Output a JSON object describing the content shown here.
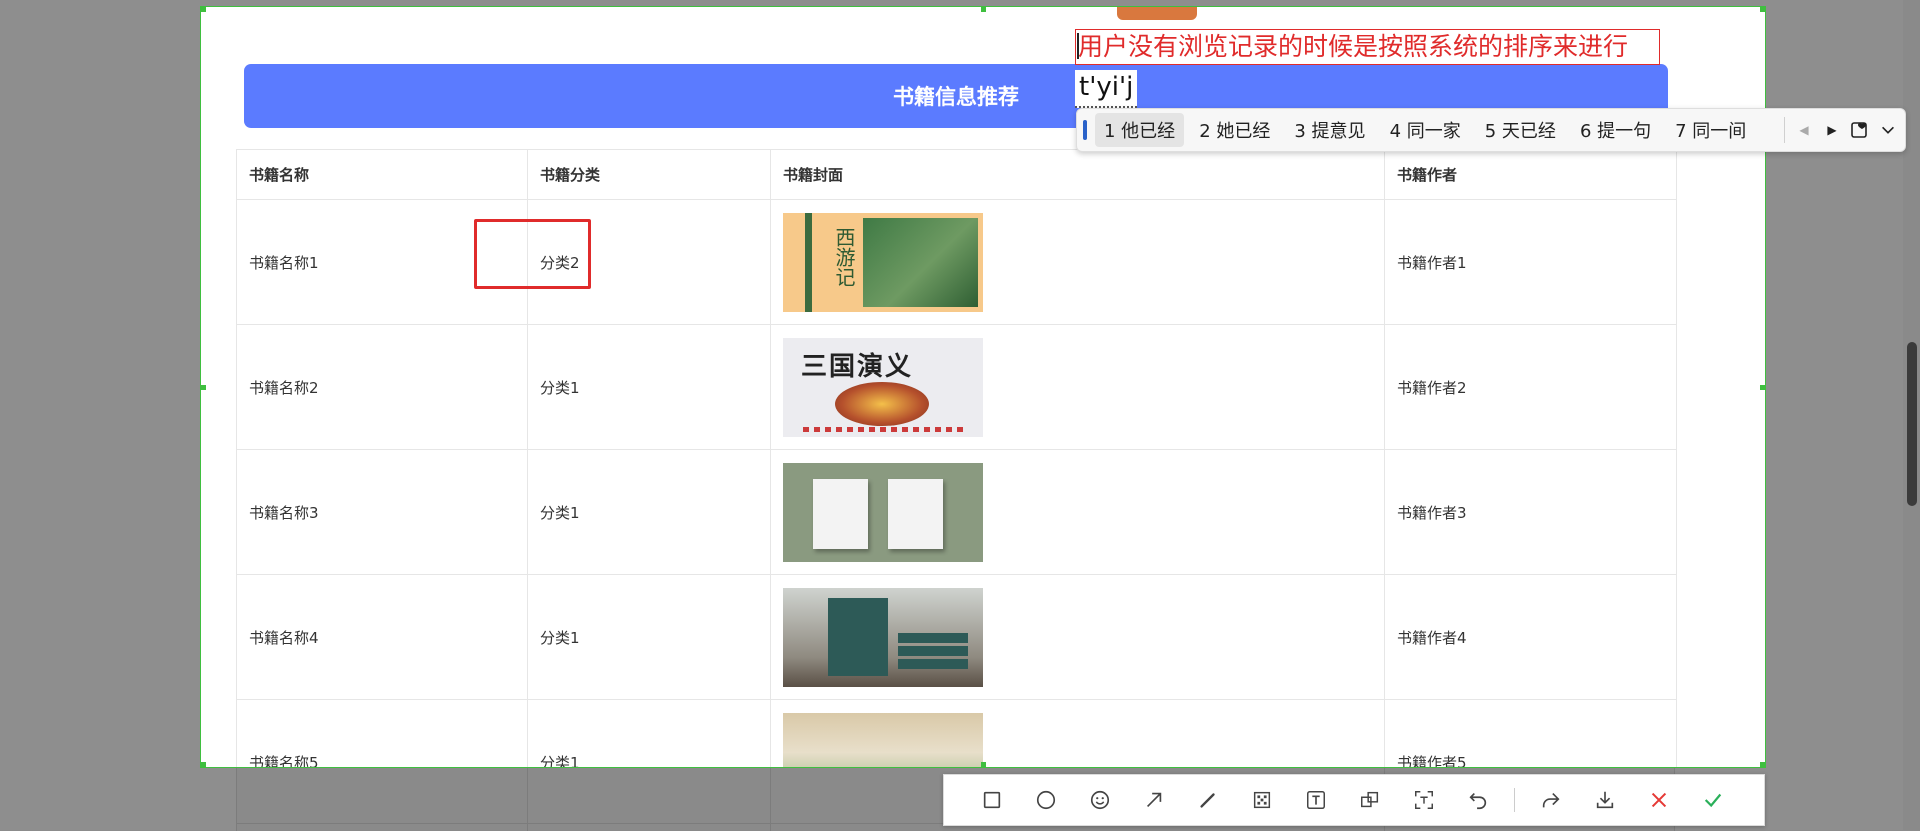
{
  "page": {
    "banner_title": "书籍信息推荐"
  },
  "table": {
    "headers": [
      "书籍名称",
      "书籍分类",
      "书籍封面",
      "书籍作者"
    ],
    "rows": [
      {
        "name": "书籍名称1",
        "category": "分类2",
        "author": "书籍作者1"
      },
      {
        "name": "书籍名称2",
        "category": "分类1",
        "author": "书籍作者2"
      },
      {
        "name": "书籍名称3",
        "category": "分类1",
        "author": "书籍作者3"
      },
      {
        "name": "书籍名称4",
        "category": "分类1",
        "author": "书籍作者4"
      },
      {
        "name": "书籍名称5",
        "category": "分类1",
        "author": "书籍作者5"
      }
    ],
    "cover_texts": {
      "cover1": "西游记",
      "cover2": "三国演义"
    }
  },
  "annotation": {
    "text": "用户没有浏览记录的时候是按照系统的排序来进行",
    "composing": "t'yi'j",
    "color": "#e02b2b"
  },
  "ime": {
    "candidates": [
      "1 他已经",
      "2 她已经",
      "3 提意见",
      "4 同一家",
      "5 天已经",
      "6 提一句",
      "7 同一间"
    ]
  },
  "toolbar": {
    "tools": [
      "rectangle-icon",
      "ellipse-icon",
      "emoji-icon",
      "arrow-icon",
      "pen-icon",
      "mosaic-icon",
      "text-icon",
      "pin-icon",
      "ocr-icon",
      "undo-icon",
      "redo-icon",
      "download-icon",
      "close-icon",
      "confirm-icon"
    ]
  },
  "colors": {
    "banner": "#5b7bff",
    "selection_border": "#3fbf3f",
    "confirm": "#2ab05a",
    "cancel": "#e53935"
  }
}
